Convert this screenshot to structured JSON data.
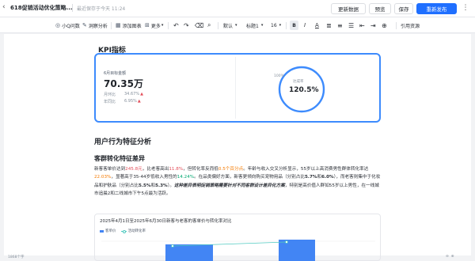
{
  "header": {
    "title": "618促销活动优化策略...",
    "status": "最近保存于今天 11:24",
    "buttons": [
      "更新数据",
      "预览",
      "保存",
      "重新发布"
    ],
    "more": "⋮",
    "back": "‹"
  },
  "toolbar": {
    "items": [
      {
        "icon": "◎",
        "label": "小Q问数"
      },
      {
        "icon": "✎",
        "label": "洞察分析"
      },
      {
        "icon": "▦",
        "label": "添加图表"
      },
      {
        "icon": "⊞",
        "label": "更多"
      },
      {
        "icon": "",
        "label": "↶"
      },
      {
        "icon": "",
        "label": "↷"
      },
      {
        "icon": "",
        "label": "⌫"
      },
      {
        "icon": "",
        "label": "⌕"
      },
      {
        "icon": "",
        "label": "默认"
      },
      {
        "icon": "",
        "label": "标题1"
      },
      {
        "icon": "",
        "label": "16"
      },
      {
        "icon": "",
        "label": "B"
      },
      {
        "icon": "",
        "label": "I"
      },
      {
        "icon": "",
        "label": "A"
      },
      {
        "icon": "",
        "label": "≣"
      },
      {
        "icon": "",
        "label": "≡"
      },
      {
        "icon": "",
        "label": "☰"
      },
      {
        "icon": "",
        "label": "⇤"
      },
      {
        "icon": "",
        "label": "⇥"
      },
      {
        "icon": "",
        "label": "⊕"
      },
      {
        "icon": "",
        "label": "引用资源"
      }
    ]
  },
  "kpi": {
    "heading": "KPI指标",
    "metric_label": "6月目标金额",
    "metric_value": "70.35万",
    "mom_label": "月环比",
    "mom_value": "34.67%",
    "yoy_label": "年同比",
    "yoy_value": "6.95%",
    "gauge_label": "达成率",
    "gauge_value": "120.5%",
    "gauge_min": "100%",
    "gauge_fraction": 1.0
  },
  "section": {
    "heading": "用户行为特征分析",
    "subheading": "客群转化特征差异",
    "paragraph": [
      {
        "t": "新客客单价达到"
      },
      {
        "t": "245.8元",
        "c": "hl-red"
      },
      {
        "t": "，比老客高出"
      },
      {
        "t": "11.8%",
        "c": "hl-red"
      },
      {
        "t": "，但转化率反而低"
      },
      {
        "t": "0.5个百分点",
        "c": "hl-orange"
      },
      {
        "t": "。年龄与收入交叉分析显示，55岁以上高消费男性群体转化率达"
      },
      {
        "t": "22.03%",
        "c": "hl-orange"
      },
      {
        "t": "，显著高于35-44岁低收入男性的"
      },
      {
        "t": "14.24%",
        "c": "hl-green"
      },
      {
        "t": "。在品类偏好方面，新客更倾向购买宠物用品（分别占比"
      },
      {
        "t": "5.7%",
        "c": "b"
      },
      {
        "t": "和"
      },
      {
        "t": "6.0%",
        "c": "b"
      },
      {
        "t": "），而老客则集中于化妆品和护肤品（分别占比"
      },
      {
        "t": "5.5%",
        "c": "b"
      },
      {
        "t": "和"
      },
      {
        "t": "5.3%",
        "c": "b"
      },
      {
        "t": "）。"
      },
      {
        "t": "这种差异表明促销策略需要针对不同客群设计差异化方案",
        "c": "it"
      },
      {
        "t": "，特别是高价值人群如55岁以上男性，在一线城市追晨2和二线城市下午5点最为活跃。"
      }
    ]
  },
  "chart_data": {
    "type": "bar",
    "title": "2025年4月1日至2025年6月30日新客与老客的客单价与转化率对比",
    "series": [
      {
        "name": "客单价",
        "type": "bar",
        "color": "#4285f4"
      },
      {
        "name": "活动转化率",
        "type": "line",
        "color": "#4fc9c0"
      }
    ]
  },
  "statusbar": {
    "wordcount": "1868个字",
    "zoom_out": "⊖",
    "zoom_in": "⊕"
  }
}
